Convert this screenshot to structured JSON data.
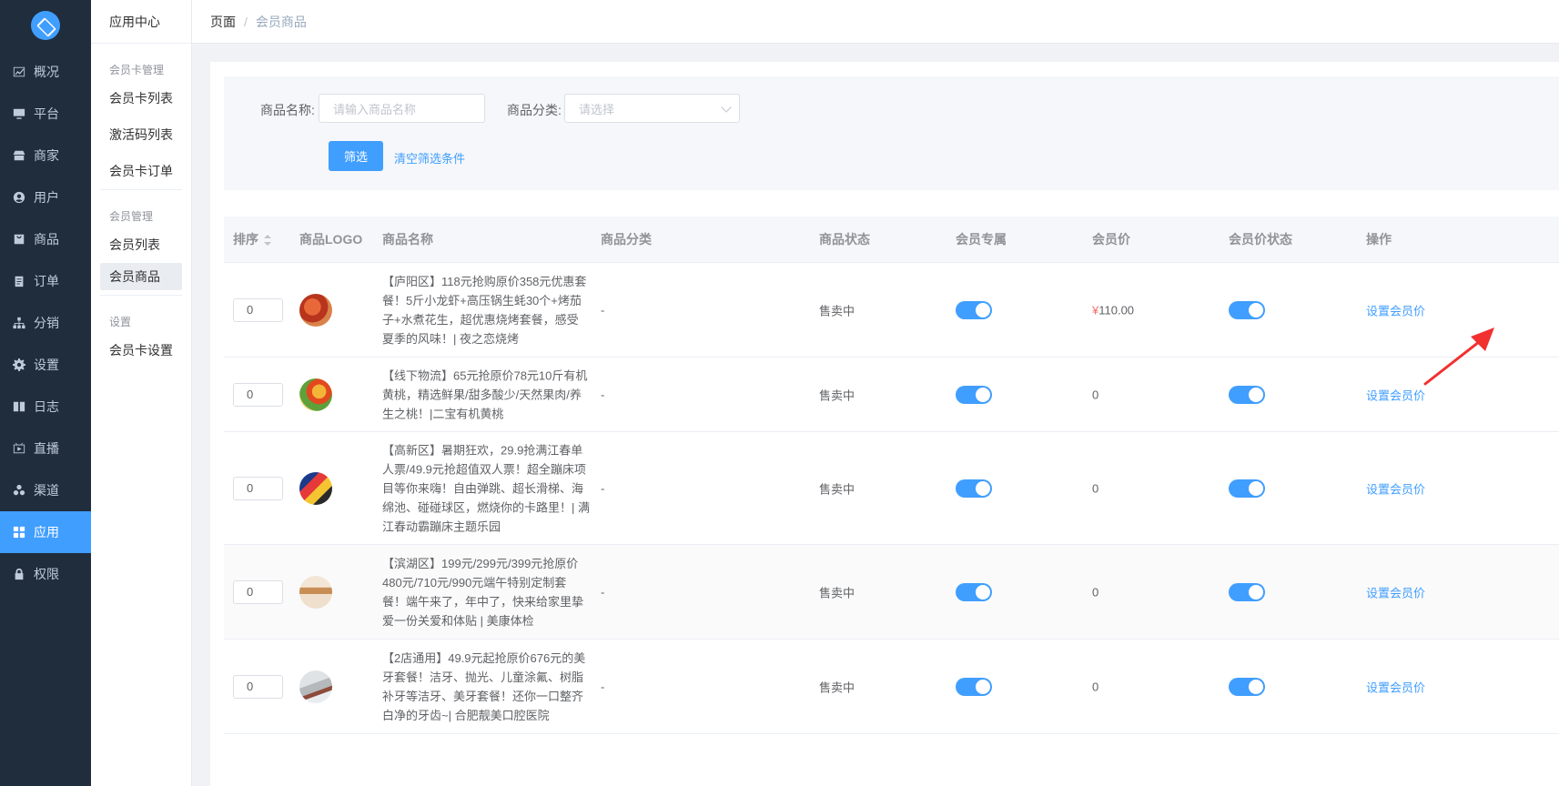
{
  "nav": {
    "items": [
      {
        "label": "概况",
        "icon": "chart-icon"
      },
      {
        "label": "平台",
        "icon": "monitor-icon"
      },
      {
        "label": "商家",
        "icon": "store-icon"
      },
      {
        "label": "用户",
        "icon": "user-icon"
      },
      {
        "label": "商品",
        "icon": "bag-icon"
      },
      {
        "label": "订单",
        "icon": "clipboard-icon"
      },
      {
        "label": "分销",
        "icon": "network-icon"
      },
      {
        "label": "设置",
        "icon": "gear-icon"
      },
      {
        "label": "日志",
        "icon": "book-icon"
      },
      {
        "label": "直播",
        "icon": "play-icon"
      },
      {
        "label": "渠道",
        "icon": "cluster-icon"
      },
      {
        "label": "应用",
        "icon": "grid-icon"
      },
      {
        "label": "权限",
        "icon": "lock-icon"
      }
    ],
    "active_index": 11
  },
  "submenu": {
    "title": "应用中心",
    "group1": "会员卡管理",
    "item1": "会员卡列表",
    "item2": "激活码列表",
    "item3": "会员卡订单",
    "group2": "会员管理",
    "item4": "会员列表",
    "item5": "会员商品",
    "group3": "设置",
    "item6": "会员卡设置"
  },
  "breadcrumb": {
    "first": "页面",
    "sep": "/",
    "last": "会员商品"
  },
  "filter": {
    "name_label": "商品名称:",
    "name_placeholder": "请输入商品名称",
    "category_label": "商品分类:",
    "category_placeholder": "请选择",
    "filter_button": "筛选",
    "clear_link": "清空筛选条件"
  },
  "table": {
    "headers": {
      "order": "排序",
      "logo": "商品LOGO",
      "name": "商品名称",
      "category": "商品分类",
      "status": "商品状态",
      "exclusive": "会员专属",
      "member_price": "会员价",
      "price_status": "会员价状态",
      "action": "操作"
    },
    "rows": [
      {
        "order": "0",
        "name": "【庐阳区】118元抢购原价358元优惠套餐！5斤小龙虾+高压锅生蚝30个+烤茄子+水煮花生，超优惠烧烤套餐，感受夏季的风味！| 夜之恋烧烤",
        "category": "-",
        "status": "售卖中",
        "member_price_symbol": "¥",
        "member_price": "110.00",
        "exclusive_on": true,
        "price_status_on": true,
        "action": "设置会员价"
      },
      {
        "order": "0",
        "name": "【线下物流】65元抢原价78元10斤有机黄桃，精选鲜果/甜多酸少/天然果肉/养生之桃！|二宝有机黄桃",
        "category": "-",
        "status": "售卖中",
        "member_price_symbol": "",
        "member_price": "0",
        "exclusive_on": true,
        "price_status_on": true,
        "action": "设置会员价"
      },
      {
        "order": "0",
        "name": "【高新区】暑期狂欢，29.9抢满江春单人票/49.9元抢超值双人票！超全蹦床项目等你来嗨！自由弹跳、超长滑梯、海绵池、碰碰球区，燃烧你的卡路里！| 满江春动霸蹦床主题乐园",
        "category": "-",
        "status": "售卖中",
        "member_price_symbol": "",
        "member_price": "0",
        "exclusive_on": true,
        "price_status_on": true,
        "action": "设置会员价"
      },
      {
        "order": "0",
        "name": "【滨湖区】199元/299元/399元抢原价480元/710元/990元端午特别定制套餐！端午来了，年中了，快来给家里挚爱一份关爱和体贴 | 美康体检",
        "category": "-",
        "status": "售卖中",
        "member_price_symbol": "",
        "member_price": "0",
        "exclusive_on": true,
        "price_status_on": true,
        "action": "设置会员价"
      },
      {
        "order": "0",
        "name": "【2店通用】49.9元起抢原价676元的美牙套餐！洁牙、抛光、儿童涂氟、树脂补牙等洁牙、美牙套餐！还你一口整齐白净的牙齿~| 合肥靓美口腔医院",
        "category": "-",
        "status": "售卖中",
        "member_price_symbol": "",
        "member_price": "0",
        "exclusive_on": true,
        "price_status_on": true,
        "action": "设置会员价"
      }
    ]
  },
  "colors": {
    "primary": "#409eff",
    "sidebar_bg": "#1f2d3d",
    "annotation_arrow": "#f23030"
  }
}
